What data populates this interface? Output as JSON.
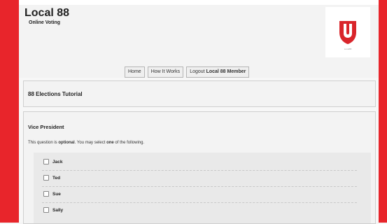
{
  "site": {
    "title": "Local 88",
    "subtitle": "Online Voting",
    "logo_text": "Local88"
  },
  "nav": {
    "home": "Home",
    "how_it_works": "How It Works",
    "logout_prefix": "Logout",
    "logout_user": "Local 88 Member"
  },
  "tutorial": {
    "title": "88 Elections Tutorial"
  },
  "question": {
    "title": "Vice President",
    "instr_1": "This question is",
    "instr_optional": "optional",
    "instr_2": ". You may select",
    "instr_one": "one",
    "instr_3": "of the following.",
    "options": [
      "Jack",
      "Ted",
      "Sue",
      "Sally"
    ]
  },
  "colors": {
    "brand_red": "#e8252b"
  }
}
